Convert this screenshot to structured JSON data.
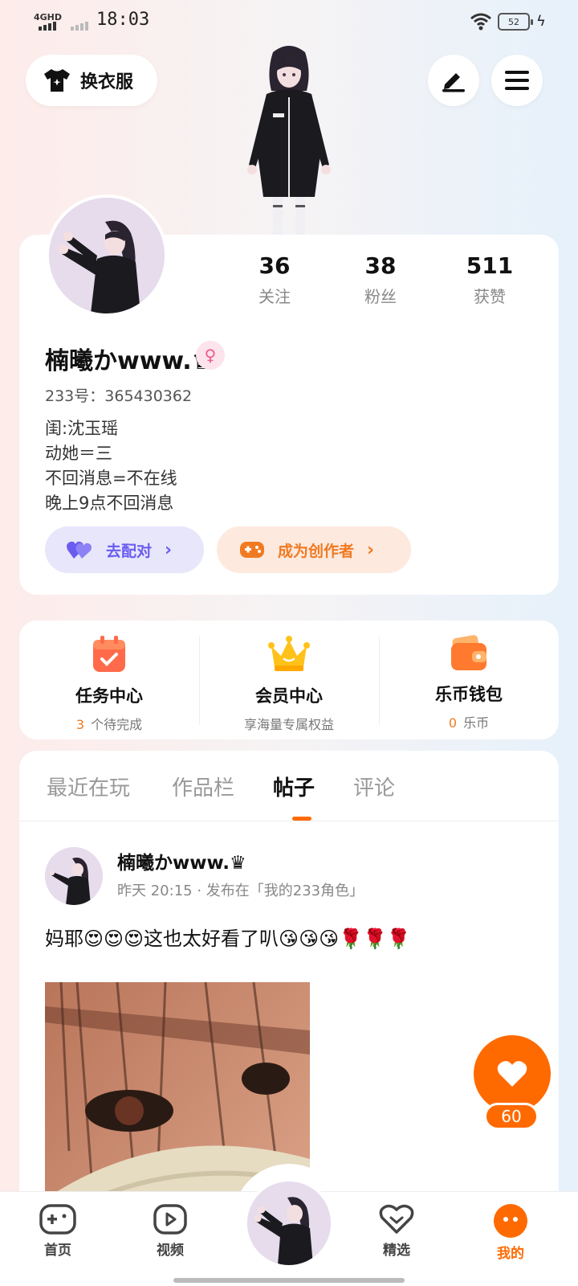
{
  "status_bar": {
    "network": "4GHD",
    "time": "18:03",
    "battery": "52"
  },
  "top": {
    "outfit_label": "换衣服"
  },
  "profile": {
    "stats": [
      {
        "value": "36",
        "label": "关注"
      },
      {
        "value": "38",
        "label": "粉丝"
      },
      {
        "value": "511",
        "label": "获赞"
      }
    ],
    "username": "楠曦かwww.♛",
    "gender_symbol": "♀",
    "uid": "233号：365430362",
    "bio_lines": [
      "闺:沈玉瑶",
      "动她＝三",
      "不回消息=不在线",
      "晚上9点不回消息"
    ],
    "match_label": "去配对",
    "creator_label": "成为创作者"
  },
  "services": [
    {
      "title": "任务中心",
      "highlight": "3",
      "sub": "个待完成"
    },
    {
      "title": "会员中心",
      "highlight": "",
      "sub": "享海量专属权益"
    },
    {
      "title": "乐币钱包",
      "highlight": "0",
      "sub": "乐币"
    }
  ],
  "tabs": [
    {
      "label": "最近在玩",
      "active": false
    },
    {
      "label": "作品栏",
      "active": false
    },
    {
      "label": "帖子",
      "active": true
    },
    {
      "label": "评论",
      "active": false
    }
  ],
  "post": {
    "author": "楠曦かwww.♛",
    "meta": "昨天 20:15 · 发布在「我的233角色」",
    "text": "妈耶😍😍😍这也太好看了叭😘😘😘🌹🌹🌹"
  },
  "like": {
    "count": "60"
  },
  "bottom_nav": [
    {
      "label": "首页",
      "icon": "gamepad-icon",
      "active": false
    },
    {
      "label": "视频",
      "icon": "play-icon",
      "active": false
    },
    {
      "label": "精选",
      "icon": "heart-icon",
      "active": false
    },
    {
      "label": "我的",
      "icon": "face-icon",
      "active": true
    }
  ],
  "colors": {
    "accent": "#ff6a00",
    "match": "#6a5cf0",
    "creator": "#f07a22"
  }
}
